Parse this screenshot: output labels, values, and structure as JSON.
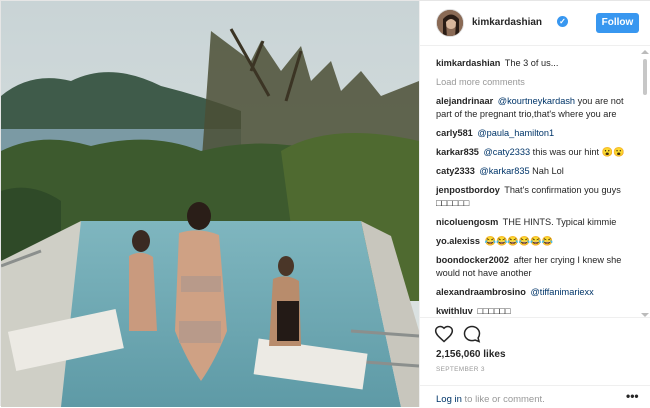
{
  "header": {
    "username": "kimkardashian",
    "follow_label": "Follow",
    "verified_glyph": "✓"
  },
  "caption": {
    "user": "kimkardashian",
    "text": "The 3 of us..."
  },
  "load_more": "Load more comments",
  "comments": [
    {
      "user": "alejandrinaar",
      "mention": "@kourtneykardash",
      "text": "you are not part of the pregnant trio,that's where you are"
    },
    {
      "user": "carly581",
      "mention": "@paula_hamilton1",
      "text": ""
    },
    {
      "user": "karkar835",
      "mention": "@caty2333",
      "text": "this was our hint 😮😮"
    },
    {
      "user": "caty2333",
      "mention": "@karkar835",
      "text": "Nah Lol"
    },
    {
      "user": "jenpostbordoy",
      "mention": "",
      "text": "That's confirmation you guys □□□□□□"
    },
    {
      "user": "nicoluengosm",
      "mention": "",
      "text": "THE HINTS. Typical kimmie"
    },
    {
      "user": "yo.alexiss",
      "mention": "",
      "text": "😂😂😂😂😂😂"
    },
    {
      "user": "boondocker2002",
      "mention": "",
      "text": "after her crying I knew she would not have another"
    },
    {
      "user": "alexandraambrosino",
      "mention": "@tiffanimariexx",
      "text": ""
    },
    {
      "user": "kwithluv",
      "mention": "",
      "text": "□□□□□□"
    }
  ],
  "likes": "2,156,060 likes",
  "date": "SEPTEMBER 3",
  "login": {
    "link": "Log in",
    "text": " to like or comment."
  },
  "more_glyph": "•••",
  "icons": {
    "like": "heart-outline-icon",
    "comment": "speech-bubble-icon",
    "more": "more-options-icon",
    "verified": "verified-badge-icon"
  },
  "colors": {
    "accent": "#3897f0",
    "link": "#003569",
    "muted": "#999999"
  }
}
